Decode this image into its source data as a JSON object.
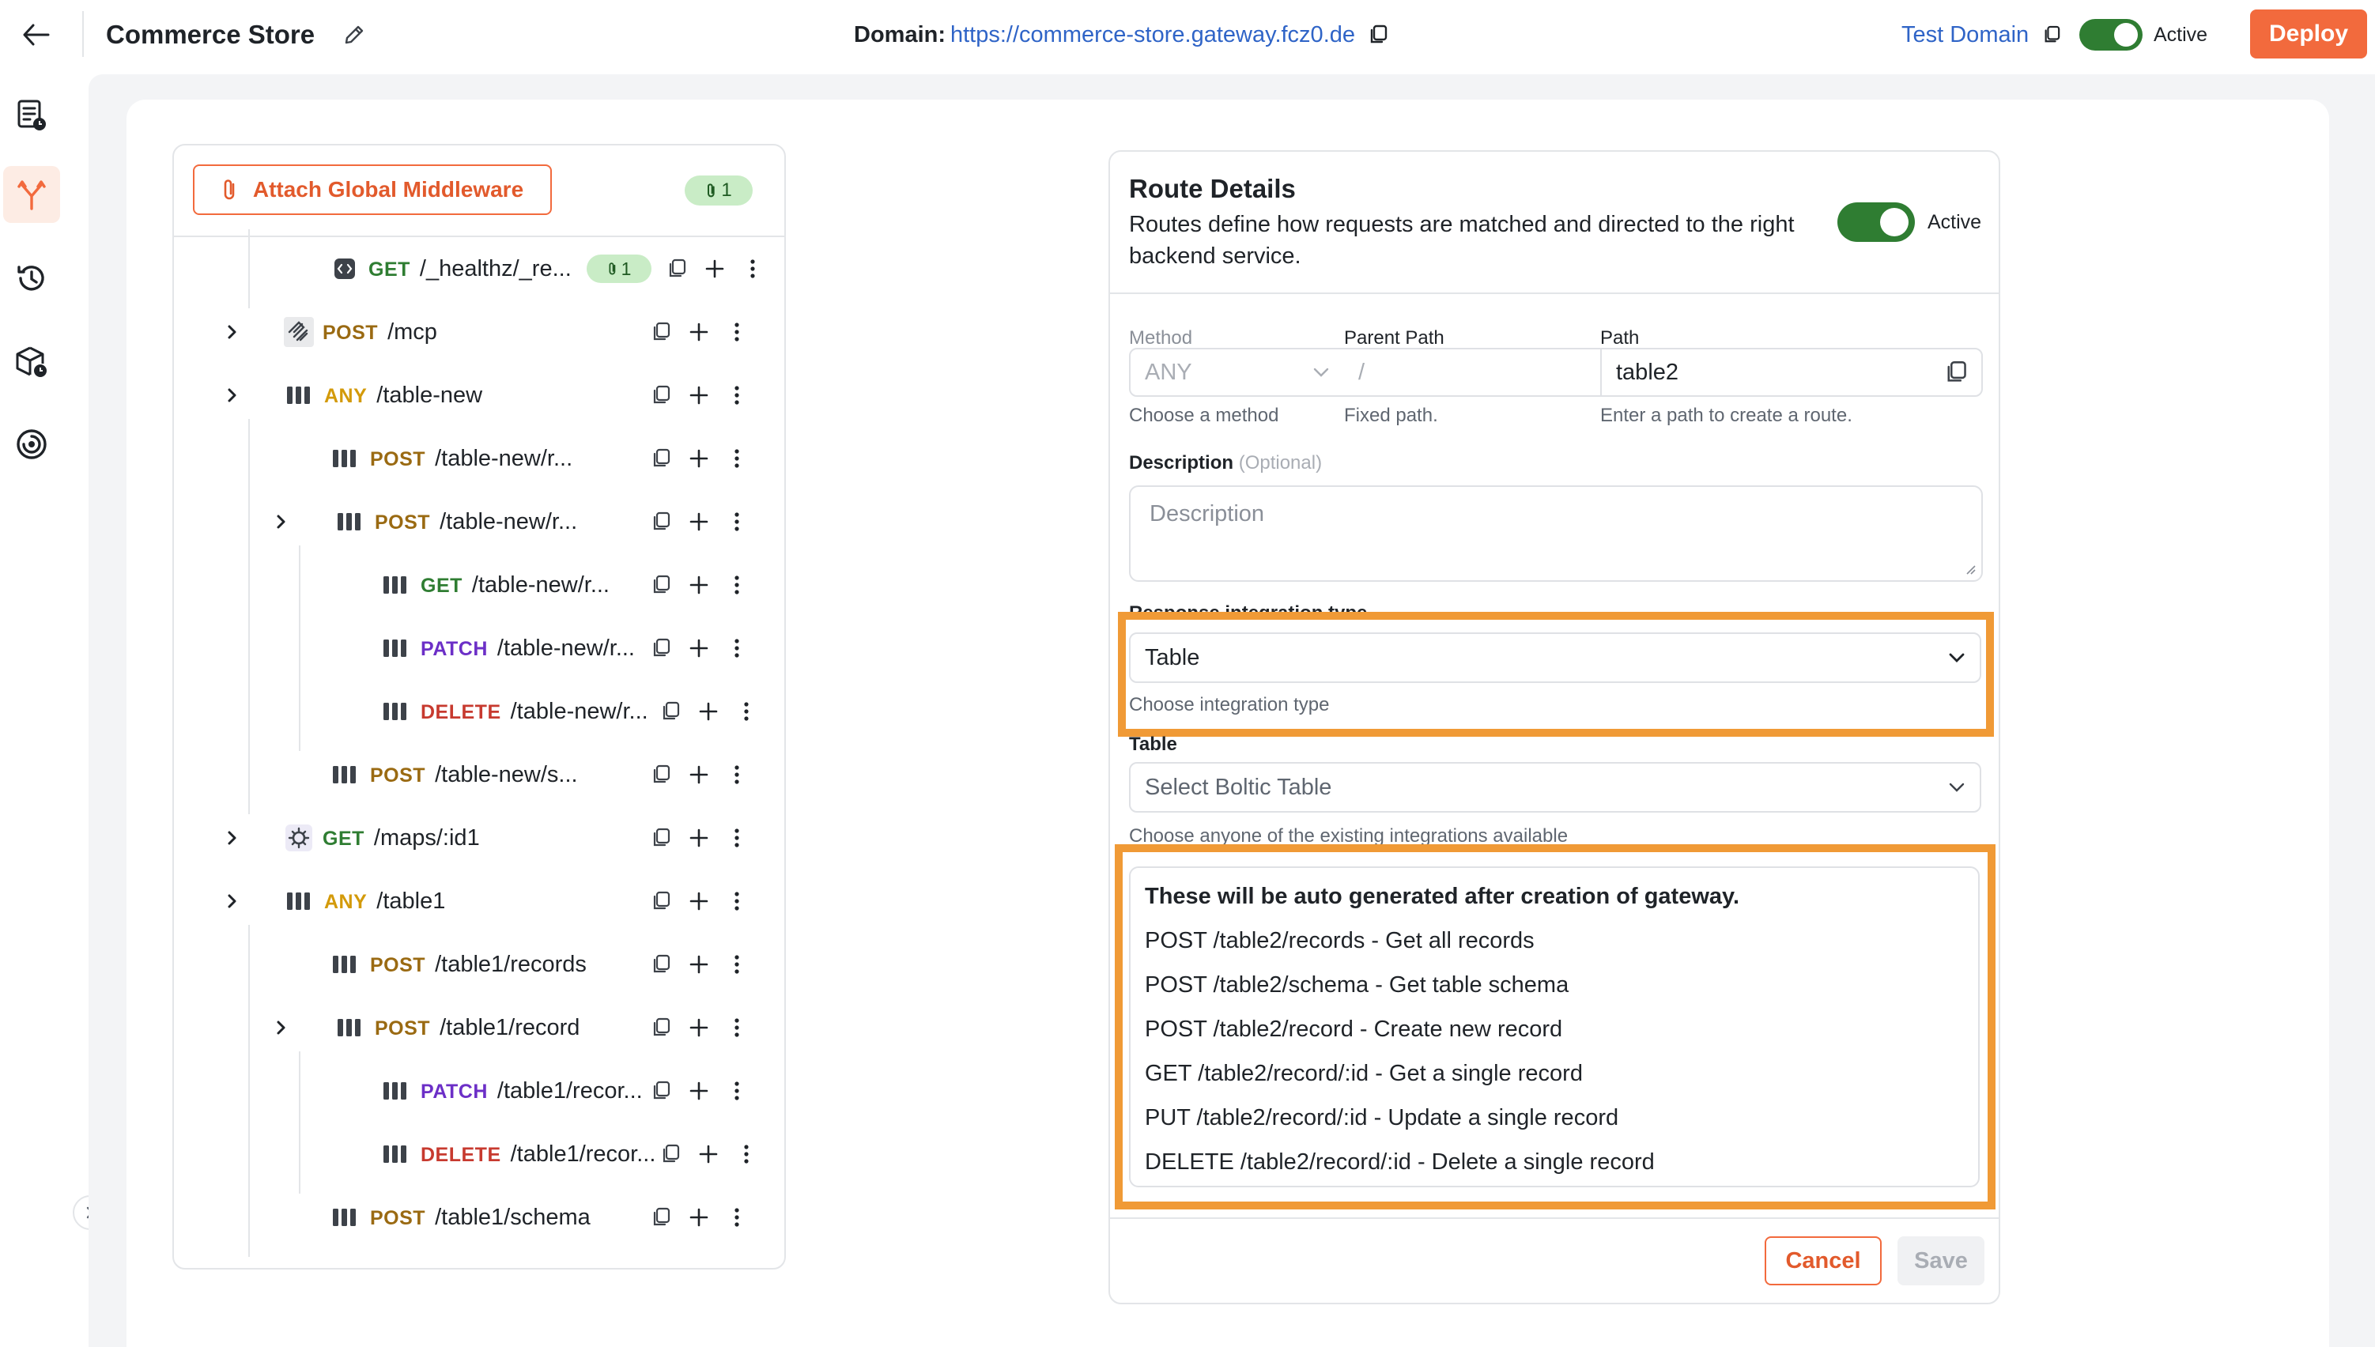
{
  "header": {
    "store_name": "Commerce Store",
    "domain_label": "Domain:",
    "domain_url": "https://commerce-store.gateway.fcz0.de",
    "test_domain": "Test Domain",
    "active_label": "Active",
    "deploy_label": "Deploy"
  },
  "rail": {
    "items": [
      "routes-doc-icon",
      "routes-branch-icon",
      "history-icon",
      "packages-icon",
      "analytics-icon"
    ],
    "active_index": 1
  },
  "tree": {
    "attach_label": "Attach Global Middleware",
    "global_middleware_count": "1",
    "rows": [
      {
        "method": "GET",
        "path": "/_healthz/_re...",
        "badge": "1"
      },
      {
        "method": "POST",
        "path": "/mcp"
      },
      {
        "method": "ANY",
        "path": "/table-new"
      },
      {
        "method": "POST",
        "path": "/table-new/r..."
      },
      {
        "method": "POST",
        "path": "/table-new/r..."
      },
      {
        "method": "GET",
        "path": "/table-new/r..."
      },
      {
        "method": "PATCH",
        "path": "/table-new/r..."
      },
      {
        "method": "DELETE",
        "path": "/table-new/r..."
      },
      {
        "method": "POST",
        "path": "/table-new/s..."
      },
      {
        "method": "GET",
        "path": "/maps/:id1"
      },
      {
        "method": "ANY",
        "path": "/table1"
      },
      {
        "method": "POST",
        "path": "/table1/records"
      },
      {
        "method": "POST",
        "path": "/table1/record"
      },
      {
        "method": "PATCH",
        "path": "/table1/recor..."
      },
      {
        "method": "DELETE",
        "path": "/table1/recor..."
      },
      {
        "method": "POST",
        "path": "/table1/schema"
      }
    ]
  },
  "details": {
    "title": "Route Details",
    "description": "Routes define how requests are matched and directed to the right backend service.",
    "active_label": "Active",
    "method_label": "Method",
    "method_value": "ANY",
    "method_hint": "Choose a method",
    "parent_path_label": "Parent Path",
    "parent_path_value": "/",
    "parent_path_hint": "Fixed path.",
    "path_label": "Path",
    "path_value": "table2",
    "path_hint": "Enter a path to create a route.",
    "description_label": "Description",
    "description_optional": "(Optional)",
    "description_placeholder": "Description",
    "integration_label": "Response integration type",
    "integration_value": "Table",
    "integration_hint": "Choose integration type",
    "table_label": "Table",
    "table_placeholder": "Select Boltic Table",
    "table_hint": "Choose anyone of the existing integrations available",
    "auto_title": "These will be auto generated after creation of gateway.",
    "auto_lines": [
      "POST /table2/records - Get all records",
      "POST /table2/schema - Get table schema",
      "POST /table2/record - Create new record",
      "GET /table2/record/:id - Get a single record",
      "PUT /table2/record/:id - Update a single record",
      "DELETE /table2/record/:id - Delete a single record"
    ],
    "cancel_label": "Cancel",
    "save_label": "Save"
  },
  "colors": {
    "accent": "#f26a3d",
    "highlight": "#f09a36",
    "toggle_on": "#2f7d32",
    "link": "#2f64c7"
  }
}
